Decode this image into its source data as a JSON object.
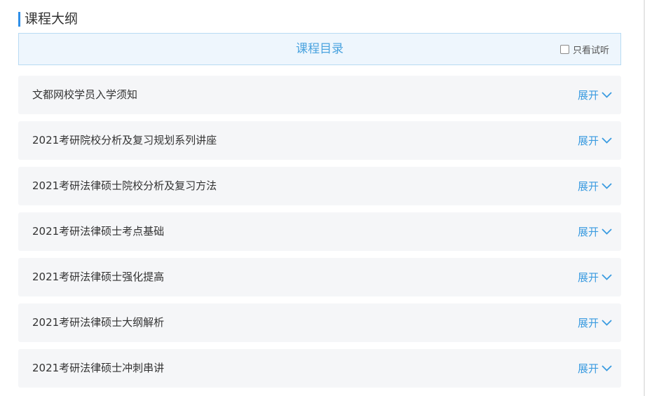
{
  "section": {
    "title": "课程大纲"
  },
  "catalog": {
    "title": "课程目录",
    "trial_filter_label": "只看试听"
  },
  "chapters": [
    {
      "name": "文都网校学员入学须知",
      "toggle_label": "展开"
    },
    {
      "name": "2021考研院校分析及复习规划系列讲座",
      "toggle_label": "展开"
    },
    {
      "name": "2021考研法律硕士院校分析及复习方法",
      "toggle_label": "展开"
    },
    {
      "name": "2021考研法律硕士考点基础",
      "toggle_label": "展开"
    },
    {
      "name": "2021考研法律硕士强化提高",
      "toggle_label": "展开"
    },
    {
      "name": "2021考研法律硕士大纲解析",
      "toggle_label": "展开"
    },
    {
      "name": "2021考研法律硕士冲刺串讲",
      "toggle_label": "展开"
    }
  ],
  "colors": {
    "accent": "#3a9be0",
    "title_bar": "#2f8fe8",
    "header_bg": "#eef6fd",
    "row_bg": "#f5f6f8"
  },
  "icons": {
    "toggle": "chevron-down-icon"
  }
}
